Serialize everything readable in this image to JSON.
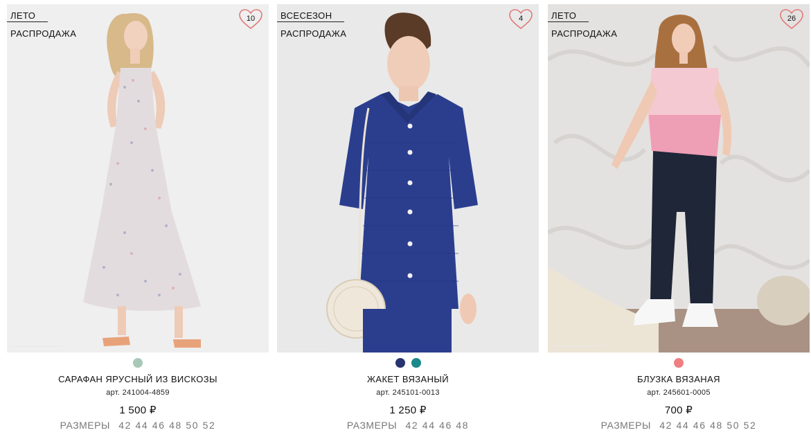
{
  "products": [
    {
      "tags": [
        "ЛЕТО",
        "РАСПРОДАЖА"
      ],
      "favorite_count": "10",
      "colors": [
        "#a9c9b8"
      ],
      "name": "САРАФАН ЯРУСНЫЙ ИЗ ВИСКОЗЫ",
      "sku": "арт. 241004-4859",
      "price": "1 500 ₽",
      "sizes_label": "РАЗМЕРЫ",
      "sizes": "42 44 46 48 50 52"
    },
    {
      "tags": [
        "ВСЕСЕЗОН",
        "РАСПРОДАЖА"
      ],
      "favorite_count": "4",
      "colors": [
        "#27346f",
        "#1b8a8a"
      ],
      "name": "ЖАКЕТ ВЯЗАНЫЙ",
      "sku": "арт. 245101-0013",
      "price": "1 250 ₽",
      "sizes_label": "РАЗМЕРЫ",
      "sizes": "42 44 46 48"
    },
    {
      "tags": [
        "ЛЕТО",
        "РАСПРОДАЖА"
      ],
      "favorite_count": "26",
      "colors": [
        "#ee7f80"
      ],
      "name": "БЛУЗКА ВЯЗАНАЯ",
      "sku": "арт. 245601-0005",
      "price": "700 ₽",
      "sizes_label": "РАЗМЕРЫ",
      "sizes": "42 44 46 48 50 52"
    }
  ],
  "icons": {
    "favorite": "heart-outline-icon"
  },
  "accent_heart_color": "#e07a7a"
}
